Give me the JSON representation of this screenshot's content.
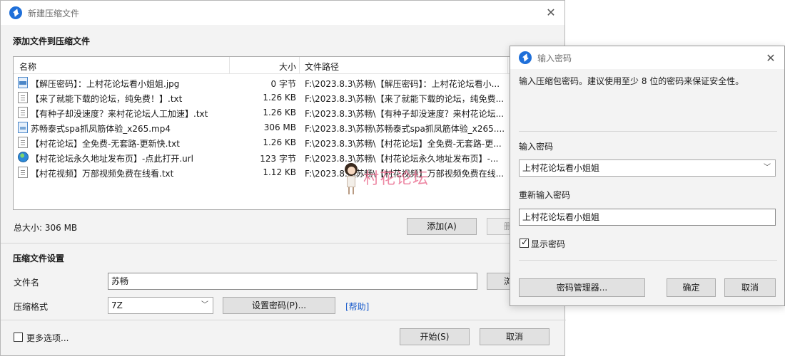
{
  "main_dialog": {
    "title": "新建压缩文件",
    "add_section_title": "添加文件到压缩文件",
    "columns": {
      "name": "名称",
      "size": "大小",
      "path": "文件路径"
    },
    "files": [
      {
        "icon": "jpg-file-icon",
        "name": "【解压密码】：上村花论坛看小姐姐.jpg",
        "size": "0 字节",
        "path": "F:\\2023.8.3\\苏畅\\【解压密码】：上村花论坛看小..."
      },
      {
        "icon": "txt-file-icon",
        "name": "【来了就能下载的论坛，纯免费！】.txt",
        "size": "1.26 KB",
        "path": "F:\\2023.8.3\\苏畅\\【来了就能下载的论坛，纯免费..."
      },
      {
        "icon": "txt-file-icon",
        "name": "【有种子却没速度？来村花论坛人工加速】.txt",
        "size": "1.26 KB",
        "path": "F:\\2023.8.3\\苏畅\\【有种子却没速度？来村花论坛..."
      },
      {
        "icon": "mp4-file-icon",
        "name": "苏畅泰式spa抓凤筋体验_x265.mp4",
        "size": "306 MB",
        "path": "F:\\2023.8.3\\苏畅\\苏畅泰式spa抓凤筋体验_x265...."
      },
      {
        "icon": "txt-file-icon",
        "name": "【村花论坛】全免费-无套路-更新快.txt",
        "size": "1.26 KB",
        "path": "F:\\2023.8.3\\苏畅\\【村花论坛】全免费-无套路-更..."
      },
      {
        "icon": "url-globe-icon",
        "name": "【村花论坛永久地址发布页】-点此打开.url",
        "size": "123 字节",
        "path": "F:\\2023.8.3\\苏畅\\【村花论坛永久地址发布页】-..."
      },
      {
        "icon": "txt-file-icon",
        "name": "【村花视频】万部视频免费在线看.txt",
        "size": "1.12 KB",
        "path": "F:\\2023.8.3\\苏畅\\【村花视频】万部视频免费在线..."
      }
    ],
    "watermark_text": "村花论坛",
    "total_size": "总大小: 306 MB",
    "add_button": "添加(A)",
    "remove_button": "删",
    "settings_title": "压缩文件设置",
    "filename_label": "文件名",
    "filename_value": "苏畅",
    "browse_button": "浏",
    "format_label": "压缩格式",
    "format_value": "7Z",
    "set_password_button": "设置密码(P)...",
    "help_link": "[帮助]",
    "more_options": "更多选项...",
    "start_button": "开始(S)",
    "cancel_button": "取消"
  },
  "password_dialog": {
    "title": "输入密码",
    "note": "输入压缩包密码。建议使用至少 8 位的密码来保证安全性。",
    "password_label": "输入密码",
    "password_value": "上村花论坛看小姐姐",
    "reenter_label": "重新输入密码",
    "reenter_value": "上村花论坛看小姐姐",
    "show_password_label": "显示密码",
    "show_password_checked": true,
    "manager_button": "密码管理器...",
    "ok_button": "确定",
    "cancel_button": "取消"
  }
}
